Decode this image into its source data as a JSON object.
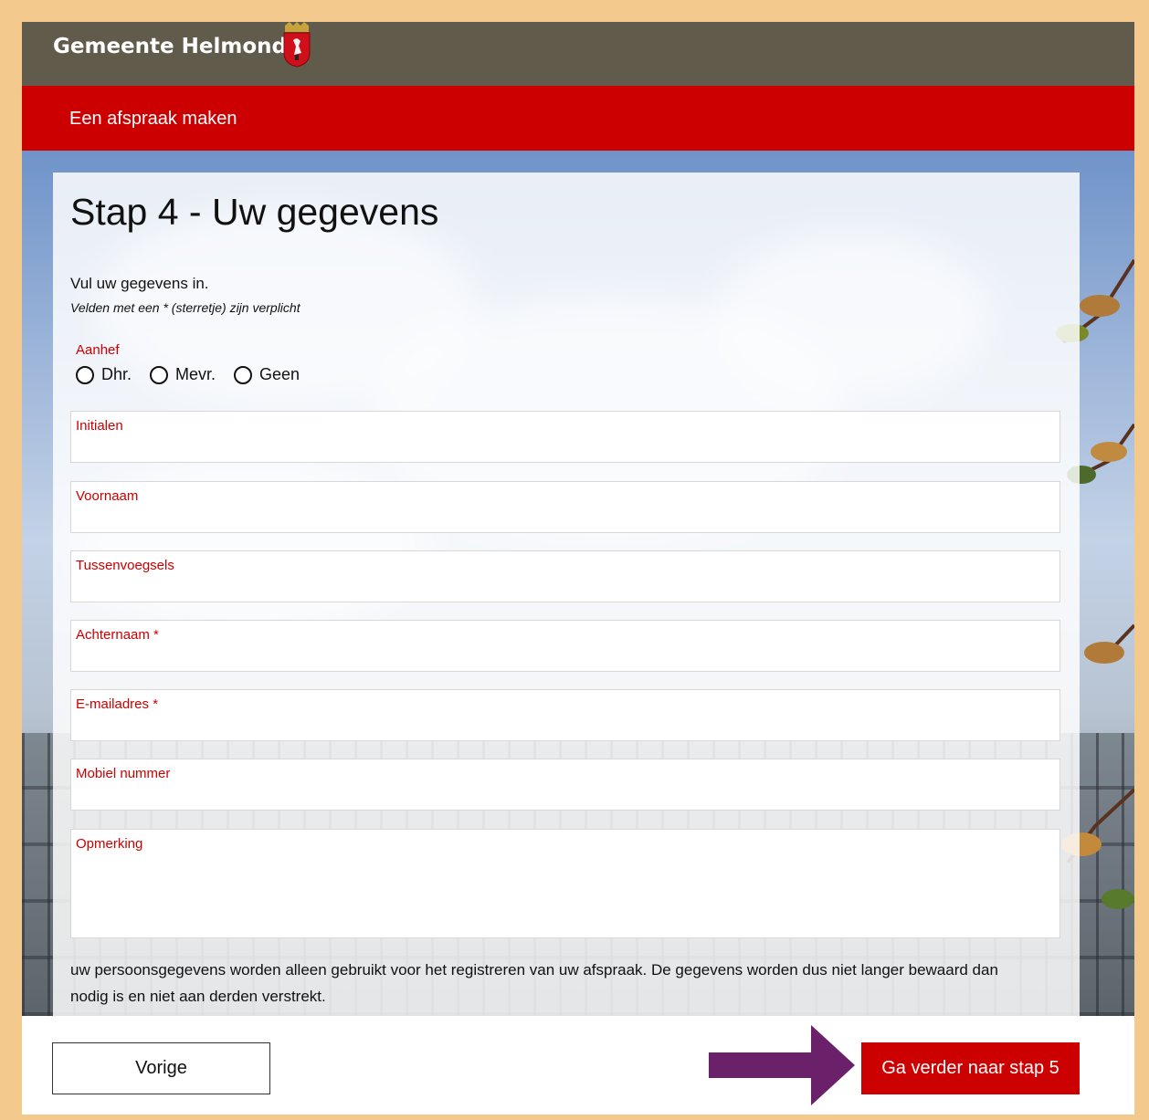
{
  "header": {
    "brand": "Gemeente Helmond",
    "section_title": "Een afspraak maken"
  },
  "form": {
    "title": "Stap 4 - Uw gegevens",
    "intro": "Vul uw gegevens in.",
    "required_note": "Velden met een * (sterretje) zijn verplicht",
    "aanhef": {
      "label": "Aanhef",
      "options": [
        "Dhr.",
        "Mevr.",
        "Geen"
      ],
      "selected": null
    },
    "fields": {
      "initialen": {
        "label": "Initialen",
        "value": ""
      },
      "voornaam": {
        "label": "Voornaam",
        "value": ""
      },
      "tussenvoegsels": {
        "label": "Tussenvoegsels",
        "value": ""
      },
      "achternaam": {
        "label": "Achternaam *",
        "value": ""
      },
      "email": {
        "label": "E-mailadres *",
        "value": ""
      },
      "mobiel": {
        "label": "Mobiel nummer",
        "value": ""
      },
      "opmerking": {
        "label": "Opmerking",
        "value": ""
      }
    },
    "privacy_text": "uw persoonsgegevens worden alleen gebruikt voor het registreren van uw afspraak. De gegevens worden dus niet langer bewaard dan nodig is en niet aan derden verstrekt."
  },
  "footer": {
    "prev_label": "Vorige",
    "next_label": "Ga verder naar stap 5"
  },
  "colors": {
    "accent_red": "#cc0000",
    "topbar": "#615b4b",
    "page_border": "#f3c98e",
    "arrow": "#6b2169"
  },
  "icons": {
    "crest": "city-crest-icon",
    "arrow": "arrow-right-icon"
  }
}
